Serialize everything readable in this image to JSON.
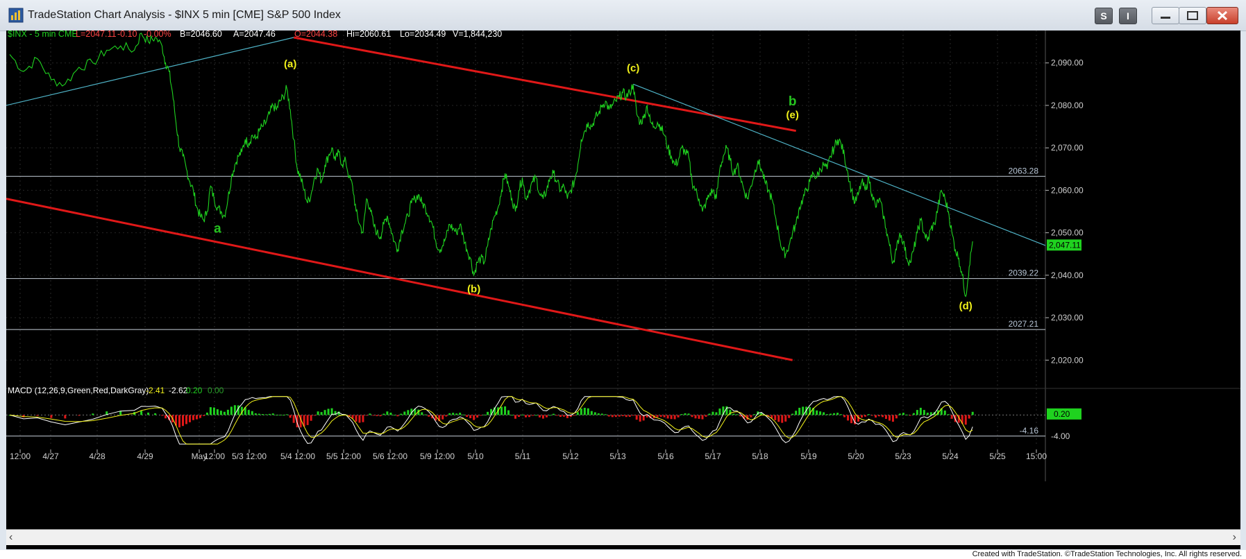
{
  "window": {
    "title": "TradeStation Chart Analysis - $INX 5 min [CME] S&P 500 Index",
    "controls": [
      "S",
      "I"
    ]
  },
  "footer": {
    "credit": "Created with TradeStation. ©TradeStation Technologies, Inc. All rights reserved."
  },
  "colors": {
    "background": "#000000",
    "price": "#1fd21f",
    "channel": "#e01818",
    "trend": "#4fb4c8",
    "hline": "#c8d0da",
    "label_yellow": "#f2f21a",
    "label_green": "#25c41f"
  },
  "chart_data": [
    {
      "type": "line",
      "header": {
        "symbol": "$INX - 5 min  CME",
        "last": "L=2047.11",
        "change": "-0.10",
        "change_pct": "-0.00%",
        "bid": "B=2046.60",
        "ask": "A=2047.46",
        "open": "O=2044.38",
        "high": "Hi=2060.61",
        "low": "Lo=2034.49",
        "volume": "V=1,844,230"
      },
      "x_ticks": [
        "12:00",
        "4/27",
        "4/28",
        "4/29",
        "May",
        "12:00",
        "5/3 12:00",
        "5/4 12:00",
        "5/5 12:00",
        "5/6 12:00",
        "5/9 12:00",
        "5/10",
        "5/11",
        "5/12",
        "5/13",
        "5/16",
        "5/17",
        "5/18",
        "5/19",
        "5/20",
        "5/23",
        "5/24",
        "5/25",
        "15:00"
      ],
      "y_ticks": [
        "2,090.00",
        "2,080.00",
        "2,070.00",
        "2,060.00",
        "2,050.00",
        "2,040.00",
        "2,030.00",
        "2,020.00"
      ],
      "ylim": [
        2014,
        2096
      ],
      "last_price_label": "2,047.11",
      "horizontal_levels": [
        {
          "value": 2063.28,
          "label": "2063.28"
        },
        {
          "value": 2039.22,
          "label": "2039.22"
        },
        {
          "value": 2027.21,
          "label": "2027.21"
        }
      ],
      "price_path": [
        [
          1,
          2092
        ],
        [
          5,
          2088
        ],
        [
          9,
          2091
        ],
        [
          13,
          2086
        ],
        [
          17,
          2085
        ],
        [
          21,
          2089
        ],
        [
          25,
          2090
        ],
        [
          29,
          2093
        ],
        [
          33,
          2094
        ],
        [
          37,
          2093
        ],
        [
          39,
          2097
        ],
        [
          41,
          2095
        ],
        [
          43,
          2096
        ],
        [
          45,
          2094
        ],
        [
          46,
          2090
        ],
        [
          47,
          2088
        ],
        [
          48,
          2083
        ],
        [
          49,
          2076
        ],
        [
          50,
          2070
        ],
        [
          51,
          2068
        ],
        [
          52,
          2065
        ],
        [
          53,
          2062
        ],
        [
          54,
          2060
        ],
        [
          55,
          2056
        ],
        [
          56,
          2054
        ],
        [
          57,
          2053
        ],
        [
          58,
          2055
        ],
        [
          59,
          2061
        ],
        [
          60,
          2058
        ],
        [
          61,
          2056
        ],
        [
          62,
          2055
        ],
        [
          63,
          2054
        ],
        [
          64,
          2058
        ],
        [
          65,
          2063
        ],
        [
          66,
          2066
        ],
        [
          67,
          2068
        ],
        [
          68,
          2069
        ],
        [
          69,
          2072
        ],
        [
          70,
          2071
        ],
        [
          71,
          2073
        ],
        [
          72,
          2072
        ],
        [
          73,
          2074
        ],
        [
          74,
          2075
        ],
        [
          75,
          2076
        ],
        [
          76,
          2078
        ],
        [
          77,
          2080
        ],
        [
          78,
          2079
        ],
        [
          79,
          2081
        ],
        [
          80,
          2082
        ],
        [
          81,
          2084
        ],
        [
          82,
          2079
        ],
        [
          83,
          2072
        ],
        [
          84,
          2065
        ],
        [
          85,
          2063
        ],
        [
          86,
          2060
        ],
        [
          87,
          2057
        ],
        [
          88,
          2059
        ],
        [
          89,
          2063
        ],
        [
          90,
          2065
        ],
        [
          91,
          2062
        ],
        [
          92,
          2066
        ],
        [
          93,
          2068
        ],
        [
          94,
          2070
        ],
        [
          95,
          2067
        ],
        [
          96,
          2069
        ],
        [
          97,
          2066
        ],
        [
          98,
          2067
        ],
        [
          99,
          2063
        ],
        [
          100,
          2061
        ],
        [
          101,
          2055
        ],
        [
          102,
          2052
        ],
        [
          103,
          2050
        ],
        [
          104,
          2058
        ],
        [
          105,
          2056
        ],
        [
          106,
          2052
        ],
        [
          107,
          2050
        ],
        [
          108,
          2049
        ],
        [
          109,
          2052
        ],
        [
          110,
          2054
        ],
        [
          111,
          2051
        ],
        [
          112,
          2048
        ],
        [
          113,
          2046
        ],
        [
          114,
          2050
        ],
        [
          115,
          2052
        ],
        [
          116,
          2054
        ],
        [
          117,
          2057
        ],
        [
          118,
          2058
        ],
        [
          119,
          2059
        ],
        [
          120,
          2057
        ],
        [
          121,
          2056
        ],
        [
          122,
          2054
        ],
        [
          123,
          2052
        ],
        [
          124,
          2048
        ],
        [
          125,
          2046
        ],
        [
          126,
          2047
        ],
        [
          127,
          2049
        ],
        [
          128,
          2052
        ],
        [
          129,
          2051
        ],
        [
          130,
          2050
        ],
        [
          131,
          2052
        ],
        [
          132,
          2049
        ],
        [
          133,
          2046
        ],
        [
          134,
          2044
        ],
        [
          135,
          2040
        ],
        [
          136,
          2043
        ],
        [
          137,
          2044
        ],
        [
          138,
          2043
        ],
        [
          139,
          2047
        ],
        [
          140,
          2051
        ],
        [
          141,
          2054
        ],
        [
          142,
          2056
        ],
        [
          143,
          2060
        ],
        [
          144,
          2064
        ],
        [
          145,
          2061
        ],
        [
          146,
          2058
        ],
        [
          147,
          2055
        ],
        [
          148,
          2060
        ],
        [
          149,
          2063
        ],
        [
          150,
          2058
        ],
        [
          151,
          2060
        ],
        [
          152,
          2062
        ],
        [
          153,
          2063
        ],
        [
          154,
          2059
        ],
        [
          155,
          2058
        ],
        [
          156,
          2060
        ],
        [
          157,
          2063
        ],
        [
          158,
          2064
        ],
        [
          159,
          2062
        ],
        [
          160,
          2060
        ],
        [
          161,
          2061
        ],
        [
          162,
          2058
        ],
        [
          163,
          2060
        ],
        [
          164,
          2062
        ],
        [
          165,
          2066
        ],
        [
          166,
          2072
        ],
        [
          167,
          2074
        ],
        [
          168,
          2076
        ],
        [
          169,
          2075
        ],
        [
          170,
          2077
        ],
        [
          171,
          2078
        ],
        [
          172,
          2080
        ],
        [
          173,
          2081
        ],
        [
          174,
          2079
        ],
        [
          175,
          2080
        ],
        [
          176,
          2081
        ],
        [
          177,
          2082
        ],
        [
          178,
          2083
        ],
        [
          179,
          2082
        ],
        [
          180,
          2083
        ],
        [
          181,
          2085
        ],
        [
          182,
          2078
        ],
        [
          183,
          2076
        ],
        [
          184,
          2077
        ],
        [
          185,
          2080
        ],
        [
          186,
          2076
        ],
        [
          187,
          2075
        ],
        [
          188,
          2076
        ],
        [
          189,
          2075
        ],
        [
          190,
          2073
        ],
        [
          191,
          2070
        ],
        [
          192,
          2068
        ],
        [
          193,
          2066
        ],
        [
          194,
          2067
        ],
        [
          195,
          2070
        ],
        [
          196,
          2069
        ],
        [
          197,
          2068
        ],
        [
          198,
          2062
        ],
        [
          199,
          2060
        ],
        [
          200,
          2058
        ],
        [
          201,
          2055
        ],
        [
          202,
          2057
        ],
        [
          203,
          2059
        ],
        [
          204,
          2060
        ],
        [
          205,
          2058
        ],
        [
          206,
          2065
        ],
        [
          207,
          2068
        ],
        [
          208,
          2070
        ],
        [
          209,
          2067
        ],
        [
          210,
          2064
        ],
        [
          211,
          2066
        ],
        [
          212,
          2063
        ],
        [
          213,
          2060
        ],
        [
          214,
          2058
        ],
        [
          215,
          2061
        ],
        [
          216,
          2064
        ],
        [
          217,
          2067
        ],
        [
          218,
          2065
        ],
        [
          219,
          2062
        ],
        [
          220,
          2060
        ],
        [
          221,
          2058
        ],
        [
          222,
          2054
        ],
        [
          223,
          2050
        ],
        [
          224,
          2046
        ],
        [
          225,
          2045
        ],
        [
          226,
          2047
        ],
        [
          227,
          2050
        ],
        [
          228,
          2052
        ],
        [
          229,
          2056
        ],
        [
          230,
          2058
        ],
        [
          231,
          2060
        ],
        [
          232,
          2062
        ],
        [
          233,
          2064
        ],
        [
          234,
          2063
        ],
        [
          235,
          2065
        ],
        [
          236,
          2066
        ],
        [
          237,
          2065
        ],
        [
          238,
          2068
        ],
        [
          239,
          2070
        ],
        [
          240,
          2072
        ],
        [
          241,
          2071
        ],
        [
          242,
          2068
        ],
        [
          243,
          2064
        ],
        [
          244,
          2060
        ],
        [
          245,
          2057
        ],
        [
          246,
          2059
        ],
        [
          247,
          2062
        ],
        [
          248,
          2060
        ],
        [
          249,
          2063
        ],
        [
          250,
          2059
        ],
        [
          251,
          2056
        ],
        [
          252,
          2058
        ],
        [
          253,
          2055
        ],
        [
          254,
          2051
        ],
        [
          255,
          2047
        ],
        [
          256,
          2043
        ],
        [
          257,
          2046
        ],
        [
          258,
          2050
        ],
        [
          259,
          2048
        ],
        [
          260,
          2044
        ],
        [
          261,
          2043
        ],
        [
          262,
          2046
        ],
        [
          263,
          2050
        ],
        [
          264,
          2053
        ],
        [
          265,
          2050
        ],
        [
          266,
          2048
        ],
        [
          267,
          2051
        ],
        [
          268,
          2052
        ],
        [
          269,
          2056
        ],
        [
          270,
          2060
        ],
        [
          271,
          2058
        ],
        [
          272,
          2055
        ],
        [
          273,
          2050
        ],
        [
          274,
          2046
        ],
        [
          275,
          2044
        ],
        [
          276,
          2040
        ],
        [
          277,
          2035
        ],
        [
          278,
          2042
        ],
        [
          279,
          2048
        ]
      ],
      "price_path_x_range": [
        0,
        300
      ],
      "trend_lines": [
        {
          "color": "red",
          "from": [
            83,
            2096
          ],
          "to": [
            228,
            2074
          ]
        },
        {
          "color": "red",
          "from": [
            0,
            2058
          ],
          "to": [
            227,
            2020
          ]
        },
        {
          "color": "cyan",
          "from": [
            0,
            2080
          ],
          "to": [
            83,
            2096
          ]
        },
        {
          "color": "cyan",
          "from": [
            181,
            2085
          ],
          "to": [
            300,
            2047
          ]
        }
      ],
      "wave_labels": [
        {
          "text": "a",
          "at": [
            61,
            2050
          ],
          "color": "green"
        },
        {
          "text": "(a)",
          "at": [
            82,
            2089
          ],
          "color": "yellow"
        },
        {
          "text": "(b)",
          "at": [
            135,
            2036
          ],
          "color": "yellow"
        },
        {
          "text": "(c)",
          "at": [
            181,
            2088
          ],
          "color": "yellow"
        },
        {
          "text": "(d)",
          "at": [
            277,
            2032
          ],
          "color": "yellow"
        },
        {
          "text": "b",
          "at": [
            227,
            2080
          ],
          "color": "green"
        },
        {
          "text": "(e)",
          "at": [
            227,
            2077
          ],
          "color": "yellow"
        }
      ]
    },
    {
      "type": "line",
      "title": "MACD (12,26,9,Green,Red,DarkGray)",
      "values_text": [
        "-2.41",
        "-2.62",
        "0.20",
        "0.00"
      ],
      "y_ticks": [
        "-4.00"
      ],
      "levels": [
        {
          "value": -4.16,
          "label": "-4.16"
        }
      ],
      "last_value_label": "0.20",
      "ylim": [
        -6,
        4
      ]
    }
  ]
}
